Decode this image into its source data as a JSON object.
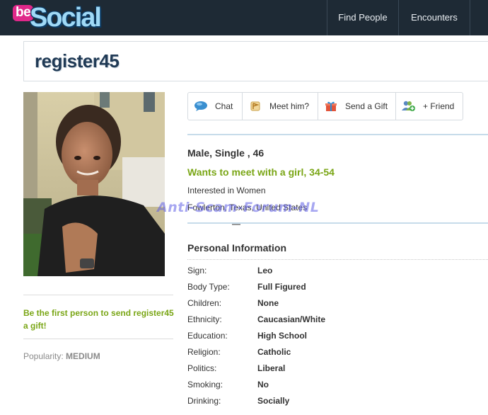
{
  "header": {
    "logo_be": "be",
    "logo_social": "Social",
    "nav": [
      "Find People",
      "Encounters"
    ],
    "bg_color": "#1e2a35"
  },
  "profile": {
    "username": "register45",
    "summary_line": "Male, Single , 46",
    "wants_line": "Wants to meet with a girl, 34-54",
    "interested": "Interested in Women",
    "location": "Fowlerton, Texas, United States"
  },
  "actions": [
    {
      "label": "Chat",
      "icon": "chat-bubble-icon"
    },
    {
      "label": "Meet him?",
      "icon": "meet-icon"
    },
    {
      "label": "Send a Gift",
      "icon": "gift-icon"
    },
    {
      "label": "+ Friend",
      "icon": "add-friend-icon"
    }
  ],
  "left": {
    "gift_prompt": "Be the first person to send register45 a gift!",
    "popularity_label": "Popularity:",
    "popularity_value": "MEDIUM"
  },
  "watermark": "Anti-Scam-Forum-NL",
  "personal_info": {
    "title": "Personal Information",
    "rows": [
      {
        "label": "Sign:",
        "value": "Leo"
      },
      {
        "label": "Body Type:",
        "value": "Full Figured"
      },
      {
        "label": "Children:",
        "value": "None"
      },
      {
        "label": "Ethnicity:",
        "value": "Caucasian/White"
      },
      {
        "label": "Education:",
        "value": "High School"
      },
      {
        "label": "Religion:",
        "value": "Catholic"
      },
      {
        "label": "Politics:",
        "value": "Liberal"
      },
      {
        "label": "Smoking:",
        "value": "No"
      },
      {
        "label": "Drinking:",
        "value": "Socially"
      }
    ]
  },
  "colors": {
    "accent_green": "#7aa616",
    "title_blue": "#203a55",
    "watermark": "#5f5fe6"
  }
}
